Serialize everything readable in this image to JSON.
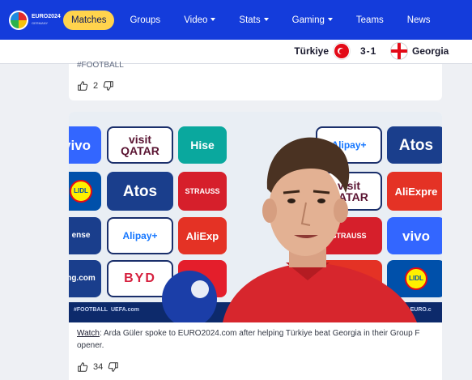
{
  "nav": {
    "logo_text": "EURO2024",
    "logo_sub": "GERMANY",
    "items": [
      {
        "label": "Matches",
        "active": true,
        "dropdown": false
      },
      {
        "label": "Groups",
        "active": false,
        "dropdown": false
      },
      {
        "label": "Video",
        "active": false,
        "dropdown": true
      },
      {
        "label": "Stats",
        "active": false,
        "dropdown": true
      },
      {
        "label": "Gaming",
        "active": false,
        "dropdown": true
      },
      {
        "label": "Teams",
        "active": false,
        "dropdown": false
      },
      {
        "label": "News",
        "active": false,
        "dropdown": false
      }
    ],
    "colors": {
      "bar": "#143cdb",
      "active_pill": "#ffd34d"
    }
  },
  "scorebar": {
    "home_team": "Türkiye",
    "score": "3-1",
    "away_team": "Georgia"
  },
  "post1": {
    "hashtag": "#FOOTBALL",
    "likes": "2"
  },
  "post2": {
    "video_sponsor_texts": {
      "qatar": "visit QATAR",
      "atos": "Atos",
      "alipay": "Alipay+",
      "vivo": "vivo",
      "hisense": "Hise",
      "aliexpress": "AliExpre",
      "strauss": "STRAUSS",
      "lidl": "LIDL",
      "byd": "BYD",
      "uefa": "UEFA.com",
      "football": "#FOOTBALL",
      "euro_footer": "EFAEURO.c"
    },
    "caption_link": "Watch",
    "caption_text": ": Arda Güler spoke to EURO2024.com after helping Türkiye beat Georgia in their Group F opener.",
    "likes": "34"
  }
}
